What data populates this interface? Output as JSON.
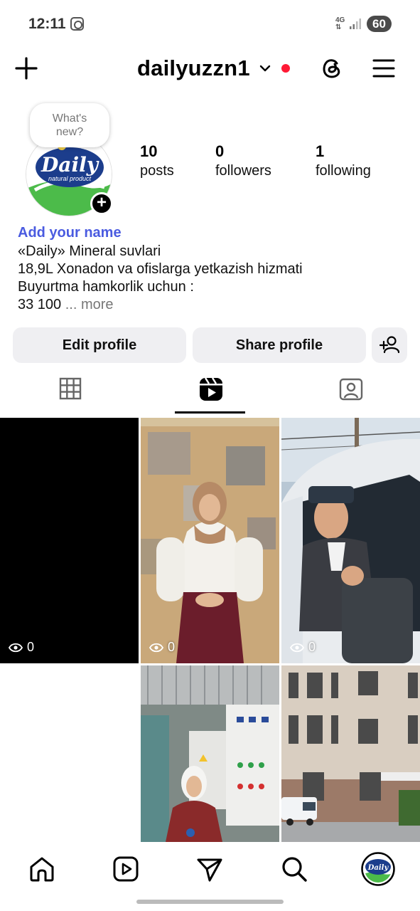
{
  "status_bar": {
    "time": "12:11",
    "network": "4G",
    "battery": "60"
  },
  "header": {
    "username": "dailyuzzn1",
    "notification_dot_color": "#ff1a35"
  },
  "profile": {
    "note_line1": "What's",
    "note_line2": "new?",
    "avatar_brand": "Daily",
    "avatar_tagline": "natural product",
    "stats": {
      "posts_count": "10",
      "posts_label": "posts",
      "followers_count": "0",
      "followers_label": "followers",
      "following_count": "1",
      "following_label": "following"
    },
    "add_name": "Add your name",
    "bio_lines": [
      "«Daily» Mineral suvlari",
      "18,9L Xonadon va ofislarga yetkazish hizmati",
      "Buyurtma hamkorlik uchun :"
    ],
    "bio_last": "33 100",
    "more_label": "... more",
    "accent_color": "#4a5be0"
  },
  "buttons": {
    "edit_profile": "Edit profile",
    "share_profile": "Share profile"
  },
  "tabs": {
    "active": "reels"
  },
  "grid": {
    "tiles": [
      {
        "views": "0",
        "kind": "black"
      },
      {
        "views": "0",
        "kind": "woman-white-blouse"
      },
      {
        "views": "0",
        "kind": "man-in-van"
      },
      {
        "views": "",
        "kind": "empty"
      },
      {
        "views": "",
        "kind": "woman-factory"
      },
      {
        "views": "",
        "kind": "building-street"
      }
    ]
  }
}
